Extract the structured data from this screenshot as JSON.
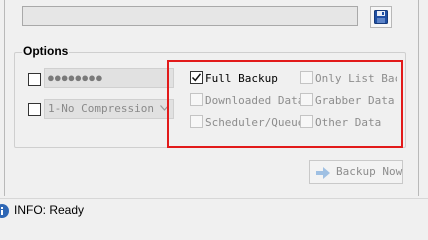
{
  "path": {
    "value": ""
  },
  "options": {
    "title": "Options",
    "password": {
      "masked_value": "●●●●●●●●",
      "checked": false
    },
    "compression": {
      "selected": "1-No Compression",
      "checked": false
    }
  },
  "backup_items": [
    {
      "label": "Full Backup",
      "checked": true,
      "enabled": true
    },
    {
      "label": "Only List Back",
      "checked": false,
      "enabled": false
    },
    {
      "label": "Downloaded Data",
      "checked": false,
      "enabled": false
    },
    {
      "label": "Grabber Data",
      "checked": false,
      "enabled": false
    },
    {
      "label": "Scheduler/Queue",
      "checked": false,
      "enabled": false
    },
    {
      "label": "Other Data",
      "checked": false,
      "enabled": false
    }
  ],
  "actions": {
    "backup_now": "Backup Now"
  },
  "status": {
    "text": "INFO: Ready"
  },
  "icons": {
    "save": "floppy-disk-icon",
    "arrow": "arrow-right-icon",
    "info": "info-icon",
    "dropdown": "chevron-down-icon"
  },
  "colors": {
    "highlight": "#e21a1a",
    "accent": "#2f67b5"
  }
}
